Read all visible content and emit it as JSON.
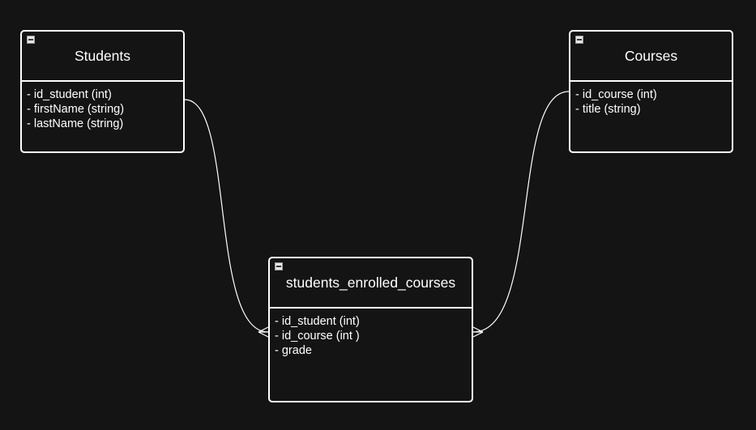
{
  "diagram": {
    "type": "er-diagram",
    "collapse_icon": "minus-square-icon",
    "colors": {
      "background": "#141414",
      "stroke": "#ffffff",
      "text": "#ffffff"
    },
    "entities": [
      {
        "id": "students",
        "title": "Students",
        "attributes": [
          "- id_student (int)",
          "- firstName (string)",
          "- lastName (string)"
        ]
      },
      {
        "id": "courses",
        "title": "Courses",
        "attributes": [
          "- id_course (int)",
          "- title (string)"
        ]
      },
      {
        "id": "students_enrolled_courses",
        "title": "students_enrolled_courses",
        "attributes": [
          "- id_student (int)",
          "- id_course (int )",
          "- grade"
        ]
      }
    ],
    "relationships": [
      {
        "from": "Students",
        "to": "students_enrolled_courses",
        "from_end": "none",
        "to_end": "crow-foot-many"
      },
      {
        "from": "Courses",
        "to": "students_enrolled_courses",
        "from_end": "none",
        "to_end": "crow-foot-many"
      }
    ]
  }
}
